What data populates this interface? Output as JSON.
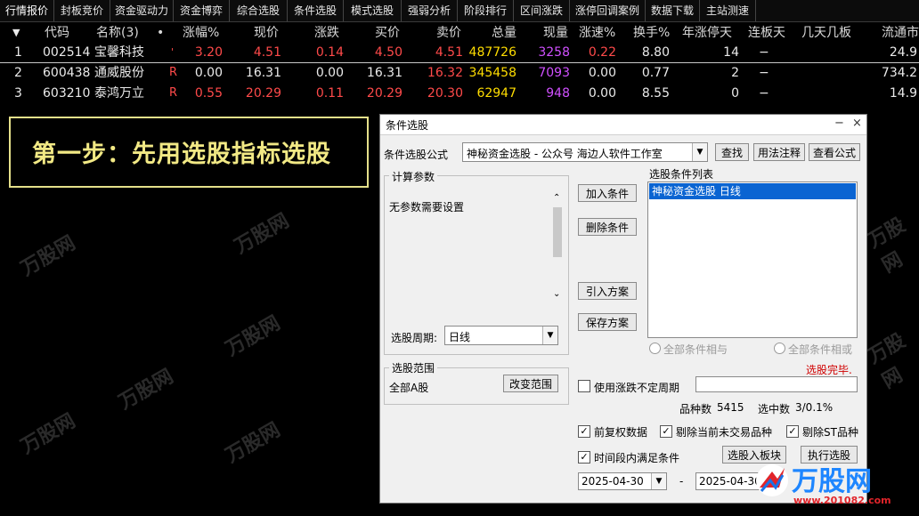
{
  "menu": {
    "tabs": [
      "行情报价",
      "封板竞价",
      "资金驱动力",
      "资金博弈",
      "综合选股",
      "条件选股",
      "模式选股",
      "强弱分析",
      "阶段排行",
      "区间涨跌",
      "涨停回调案例",
      "数据下载",
      "主站测速"
    ]
  },
  "table": {
    "sort_arrow": "▼",
    "columns": [
      "代码",
      "名称(3)",
      "•",
      "涨幅%",
      "现价",
      "涨跌",
      "买价",
      "卖价",
      "总量",
      "现量",
      "涨速%",
      "换手%",
      "年涨停天",
      "连板天",
      "几天几板",
      "流通市"
    ],
    "rows": [
      {
        "idx": "1",
        "code": "002514",
        "name": "宝馨科技",
        "flag": "'",
        "pct": "3.20",
        "price": "4.51",
        "chg": "0.14",
        "bid": "4.50",
        "ask": "4.51",
        "vol": "487726",
        "cur": "3258",
        "speed": "0.22",
        "turn": "8.80",
        "ztdays": "14",
        "lb": "−",
        "jtjb": "",
        "mkt": "24.9"
      },
      {
        "idx": "2",
        "code": "600438",
        "name": "通威股份",
        "flag": "R",
        "pct": "0.00",
        "price": "16.31",
        "chg": "0.00",
        "bid": "16.31",
        "ask": "16.32",
        "vol": "345458",
        "cur": "7093",
        "speed": "0.00",
        "turn": "0.77",
        "ztdays": "2",
        "lb": "−",
        "jtjb": "",
        "mkt": "734.2"
      },
      {
        "idx": "3",
        "code": "603210",
        "name": "泰鸿万立",
        "flag": "R",
        "pct": "0.55",
        "price": "20.29",
        "chg": "0.11",
        "bid": "20.29",
        "ask": "20.30",
        "vol": "62947",
        "cur": "948",
        "speed": "0.00",
        "turn": "8.55",
        "ztdays": "0",
        "lb": "−",
        "jtjb": "",
        "mkt": "14.9"
      }
    ]
  },
  "caption": "第一步：先用选股指标选股",
  "watermark": "万股网",
  "dialog": {
    "title": "条件选股",
    "win_min": "−",
    "win_close": "×",
    "formula_label": "条件选股公式",
    "formula_value": "神秘资金选股 - 公众号 海边人软件工作室",
    "btn_find": "查找",
    "btn_usage": "用法注释",
    "btn_view": "查看公式",
    "params_title": "计算参数",
    "params_text": "无参数需要设置",
    "period_label": "选股周期:",
    "period_value": "日线",
    "btn_add": "加入条件",
    "btn_delete": "删除条件",
    "btn_import": "引入方案",
    "btn_save": "保存方案",
    "list_title": "选股条件列表",
    "list_items": [
      "神秘资金选股  日线"
    ],
    "radio_and": "全部条件相与",
    "radio_or": "全部条件相或",
    "status": "选股完毕.",
    "range_title": "选股范围",
    "range_value": "全部A股",
    "btn_change_range": "改变范围",
    "cb_unfixed": "使用涨跌不定周期",
    "count_label": "品种数",
    "count_value": "5415",
    "selected_label": "选中数",
    "selected_value": "3/0.1%",
    "cb_adjust": "前复权数据",
    "cb_no_trade": "剔除当前未交易品种",
    "cb_no_st": "剔除ST品种",
    "cb_period": "时间段内满足条件",
    "btn_to_block": "选股入板块",
    "btn_execute": "执行选股",
    "date_from": "2025-04-30",
    "date_sep": "-",
    "date_to": "2025-04-30"
  },
  "brand": {
    "logo": "万股网",
    "url": "www.201082.com"
  }
}
